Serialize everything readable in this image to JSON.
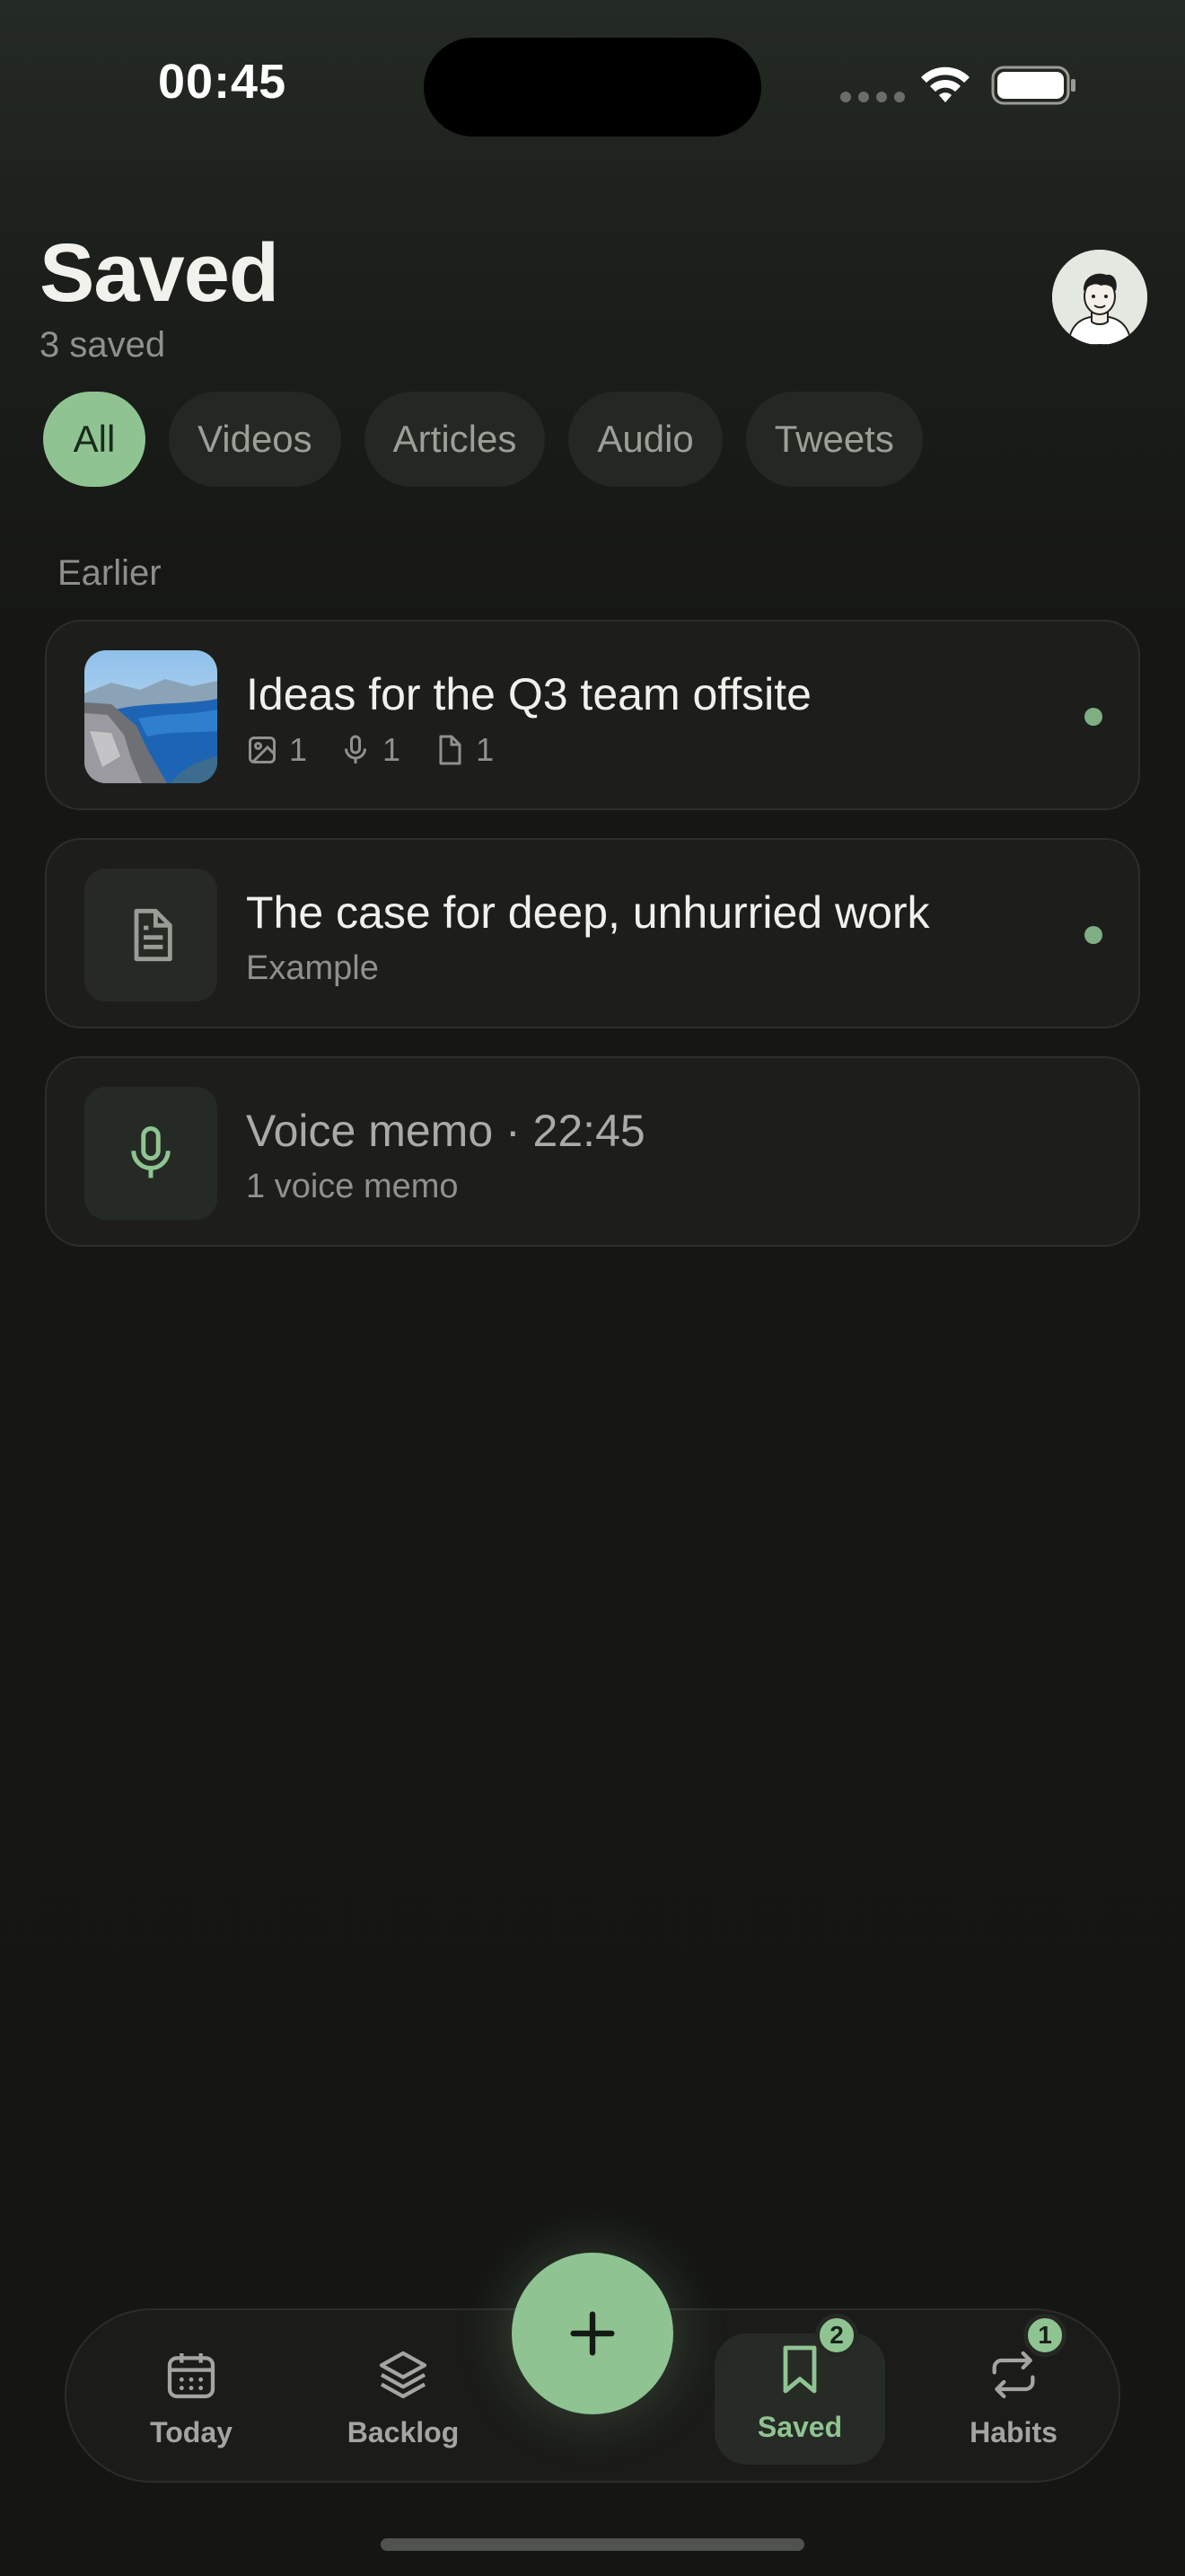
{
  "status_bar": {
    "time": "00:45"
  },
  "header": {
    "title": "Saved",
    "count_label": "3 saved"
  },
  "filters": [
    {
      "label": "All",
      "active": true
    },
    {
      "label": "Videos",
      "active": false
    },
    {
      "label": "Articles",
      "active": false
    },
    {
      "label": "Audio",
      "active": false
    },
    {
      "label": "Tweets",
      "active": false
    }
  ],
  "section": {
    "label": "Earlier"
  },
  "items": [
    {
      "title": "Ideas for the Q3 team offsite",
      "thumbnail": "landscape-photo",
      "meta": {
        "images": "1",
        "voice": "1",
        "files": "1"
      },
      "unread": true
    },
    {
      "title": "The case for deep, unhurried work",
      "subtitle": "Example",
      "icon": "document-icon",
      "unread": true
    },
    {
      "title": "Voice memo · 22:45",
      "subtitle": "1 voice memo",
      "icon": "microphone-icon",
      "unread": false
    }
  ],
  "nav": {
    "today": {
      "label": "Today",
      "icon": "calendar-icon"
    },
    "backlog": {
      "label": "Backlog",
      "icon": "layers-icon"
    },
    "saved": {
      "label": "Saved",
      "icon": "bookmark-icon",
      "badge": "2",
      "active": true
    },
    "habits": {
      "label": "Habits",
      "icon": "repeat-icon",
      "badge": "1"
    },
    "fab": {
      "icon": "plus-icon"
    }
  },
  "colors": {
    "accent": "#8fc492",
    "background": "#151614",
    "card": "#1d1e1b"
  }
}
